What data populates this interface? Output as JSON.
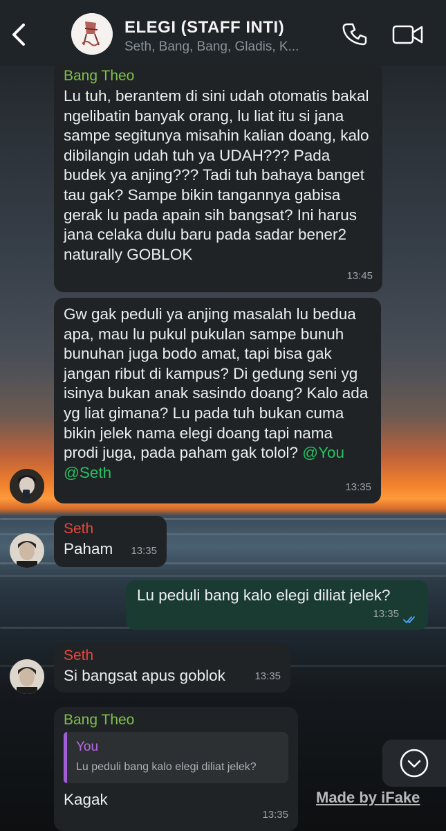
{
  "header": {
    "title": "ELEGI (STAFF INTI)",
    "subtitle": "Seth, Bang, Bang, Gladis, K..."
  },
  "messages": [
    {
      "sender": "Bang Theo",
      "text": "Lu tuh, berantem di sini udah otomatis bakal ngelibatin banyak orang, lu liat itu si jana sampe segitunya misahin kalian doang, kalo dibilangin udah tuh ya UDAH??? Pada budek ya anjing??? Tadi tuh bahaya banget tau gak? Sampe bikin tangannya gabisa gerak lu pada apain sih bangsat? Ini harus jana celaka dulu baru pada sadar bener2 naturally GOBLOK",
      "time": "13:45"
    },
    {
      "text": "Gw gak peduli ya anjing masalah lu bedua apa, mau lu pukul pukulan sampe bunuh bunuhan juga bodo amat, tapi bisa gak jangan ribut di kampus? Di gedung seni yg isinya bukan anak sasindo doang? Kalo ada yg liat gimana? Lu pada tuh bukan cuma bikin jelek nama elegi doang tapi nama prodi juga, pada paham gak tolol?",
      "mention1": "@You",
      "mention2": "@Seth",
      "time": "13:35"
    },
    {
      "sender": "Seth",
      "text": "Paham",
      "time": "13:35"
    },
    {
      "text": "Lu peduli bang kalo elegi diliat jelek?",
      "time": "13:35"
    },
    {
      "sender": "Seth",
      "text": "Si bangsat apus goblok",
      "time": "13:35"
    },
    {
      "sender": "Bang Theo",
      "reply_name": "You",
      "reply_text": "Lu peduli bang kalo elegi diliat jelek?",
      "text": "Kagak",
      "time": "13:35"
    }
  ],
  "watermark": "Made by iFake",
  "colors": {
    "header_bg": "#1f2428",
    "incoming_bubble": "#202326",
    "outgoing_bubble": "#1a3b31",
    "sender_green": "#7fc04a",
    "sender_red": "#e8463d",
    "mention": "#25c15f",
    "read_tick": "#4fa3f7",
    "reply_purple": "#b76be3"
  },
  "icons": [
    "back-chevron-icon",
    "group-avatar",
    "phone-icon",
    "video-camera-icon",
    "double-check-icon",
    "chevron-down-icon"
  ]
}
